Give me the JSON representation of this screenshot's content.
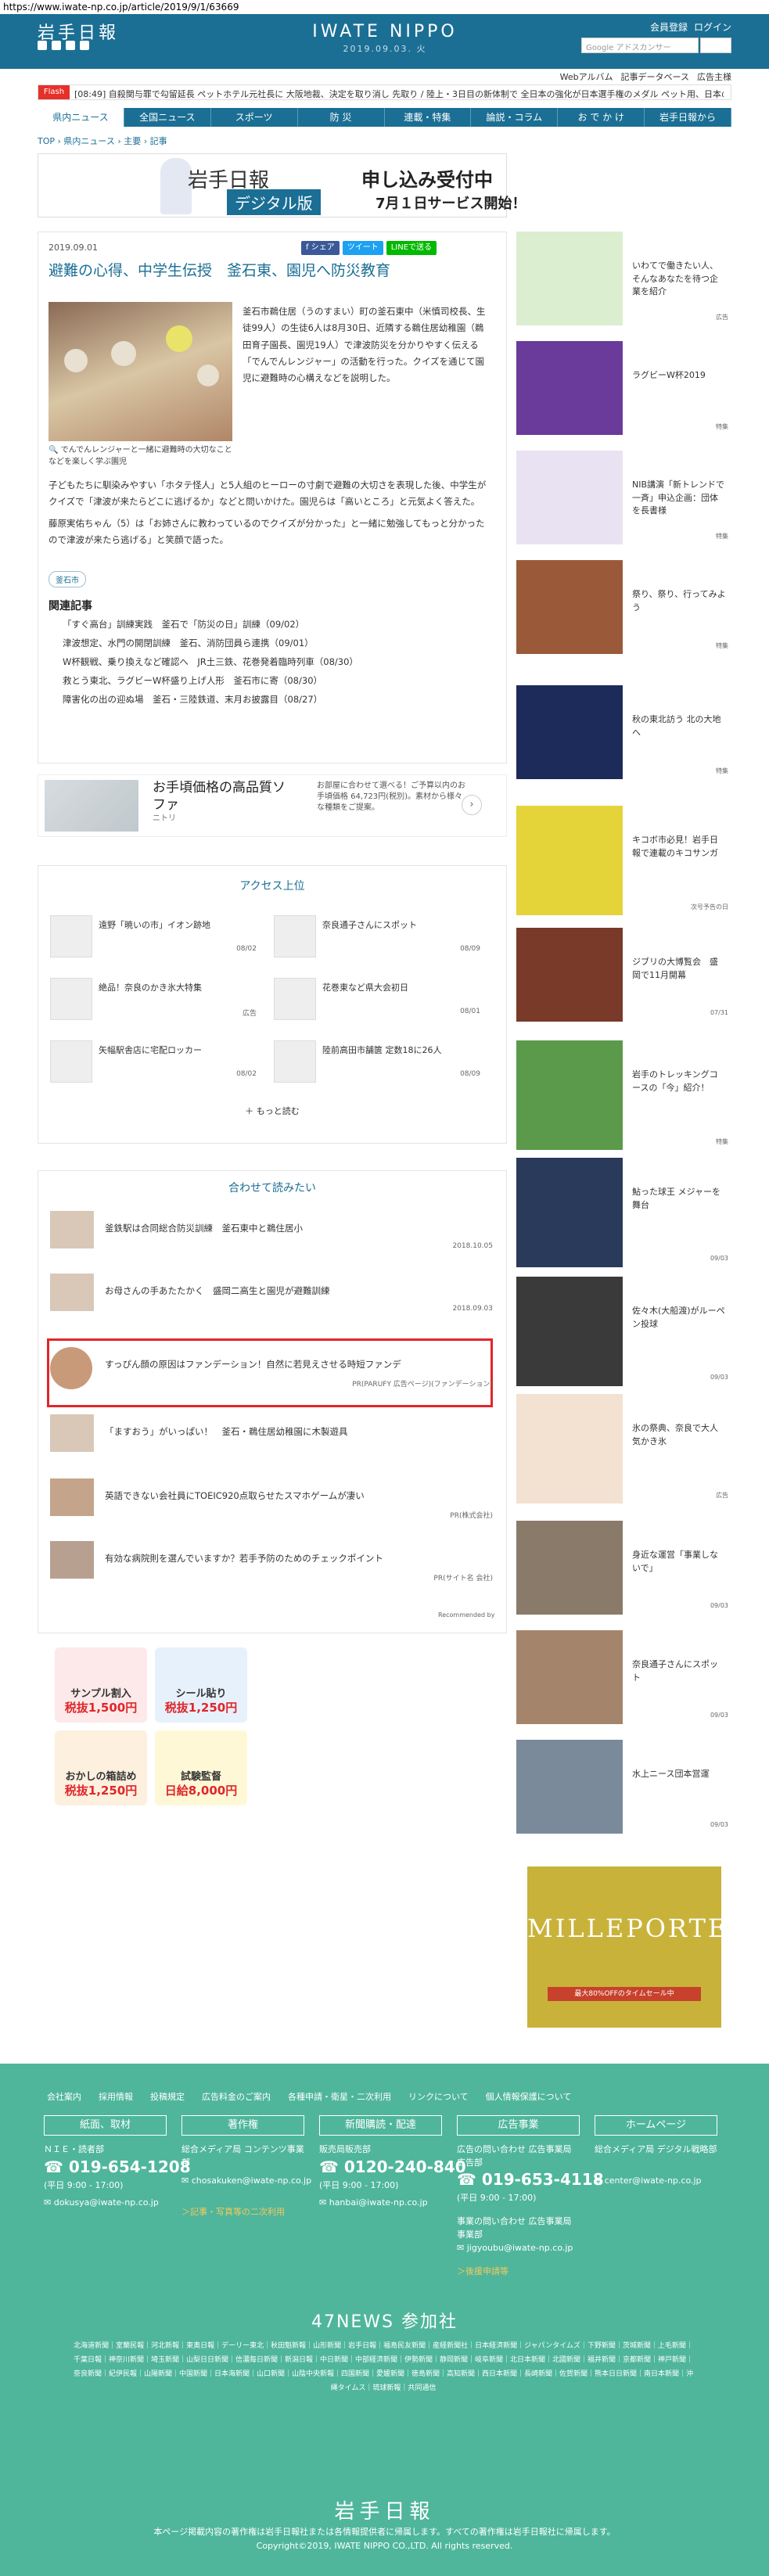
{
  "url": "https://www.iwate-np.co.jp/article/2019/9/1/63669",
  "header": {
    "logo": "岩手日報",
    "center_logo": "IWATE NIPPO",
    "date": "2019.09.03. 火",
    "member_links": [
      "会員登録",
      "ログイン"
    ],
    "search_placeholder": "Google アドスカンサー",
    "sublinks": [
      "Webアルバム",
      "記事データベース",
      "広告主様"
    ]
  },
  "flash": {
    "tag": "Flash",
    "text": "[08:49] 自殺関与罪で勾留延長 ペットホテル元社長に 大阪地裁、決定を取り消し 先取り / 陸上・3日目の新体制で 全日本の強化が日本選手権のメダル ペット用、日本の陸上競技 水泳 1-12"
  },
  "nav": [
    "県内ニュース",
    "全国ニュース",
    "スポーツ",
    "防 災",
    "連載・特集",
    "論説・コラム",
    "お で か け",
    "岩手日報から"
  ],
  "breadcrumb": "TOP › 県内ニュース › 主要 › 記事",
  "banner": {
    "logo": "岩手日報",
    "sub": "デジタル版",
    "main": "申し込み受付中",
    "date": "7月１日サービス開始！"
  },
  "article": {
    "date": "2019.09.01",
    "share": [
      "f シェア",
      "ツイート",
      "LINEで送る"
    ],
    "title": "避難の心得、中学生伝授　釜石東、園児へ防災教育",
    "caption": "でんでんレンジャーと一緒に避難時の大切なことなどを楽しく学ぶ園児",
    "body1": "釜石市鵜住居（うのすまい）町の釜石東中（米慎司校長、生徒99人）の生徒6人は8月30日、近隣する鵜住居幼稚園（鵜田育子園長、園児19人）で津波防災を分かりやすく伝える「でんでんレンジャー」の活動を行った。クイズを通じて園児に避難時の心構えなどを説明した。",
    "body2": "子どもたちに馴染みやすい「ホタテ怪人」と5人組のヒーローの寸劇で避難の大切さを表現した後、中学生がクイズで「津波が来たらどこに逃げるか」などと問いかけた。園児らは「高いところ」と元気よく答えた。",
    "body3": "藤原実佑ちゃん（5）は「お姉さんに教わっているのでクイズが分かった」と一緒に勉強してもっと分かったので津波が来たら逃げる」と笑顔で語った。",
    "tag": "釜石市",
    "related_heading": "関連記事",
    "related": [
      "「すぐ高台」訓練実践　釜石で「防災の日」訓練（09/02）",
      "津波想定、水門の開閉訓練　釜石、消防団員ら連携（09/01）",
      "W杯観戦、乗り換えなど確認へ　JR土三鉄、花巻発着臨時列車（08/30）",
      "救とう東北、ラグビーW杯盛り上げ人形　釜石市に寄（08/30）",
      "障害化の出の迎ぬ場　釜石・三陸鉄道、末月お披露目（08/27）"
    ]
  },
  "ad1": {
    "title": "お手頃価格の高品質ソファ",
    "brand": "ニトリ",
    "text": "お部屋に合わせて選べる！ご予算以内のお手頃価格 64,723円(税別)。素材から様々な種類をご提案。"
  },
  "ranking": {
    "heading": "アクセス上位",
    "items": [
      {
        "title": "遠野「暁いの市」イオン跡地",
        "date": "08/02"
      },
      {
        "title": "奈良通子さんにスポット",
        "date": "08/09"
      },
      {
        "title": "絶品！奈良のかき氷大特集",
        "date": "広告"
      },
      {
        "title": "花巻東など県大会初日",
        "date": "08/01"
      },
      {
        "title": "矢幅駅舎店に宅配ロッカー",
        "date": "08/02"
      },
      {
        "title": "陸前高田市舗篋 定数18に26人",
        "date": "08/09"
      }
    ],
    "more": "もっと読む"
  },
  "reco": {
    "heading": "合わせて読みたい",
    "items": [
      {
        "title": "釜鉄駅は合同総合防災訓練　釜石東中と鵜住居小",
        "meta": "2018.10.05"
      },
      {
        "title": "お母さんの手あたたかく　盛岡二高生と園児が避難訓練",
        "meta": "2018.09.03"
      },
      {
        "title": "すっぴん顔の原因はファンデーション！自然に若見えさせる時短ファンデ",
        "meta": "PR(PARUFY 広告ページ)(ファンデーション)"
      },
      {
        "title": "「ますおう」がいっぱい！　釜石・鵜住居幼稚園に木製遊具",
        "meta": ""
      },
      {
        "title": "英語できない会社員にTOEIC920点取らせたスマホゲームが凄い",
        "meta": "PR(株式会社)"
      },
      {
        "title": "有効な病院則を選んでいますか？若手予防のためのチェックポイント",
        "meta": "PR(サイト名 会社)"
      }
    ],
    "recommended": "Recommended by"
  },
  "ad2": [
    {
      "title": "サンプル割入",
      "price": "税抜1,500円"
    },
    {
      "title": "シール貼り",
      "price": "税抜1,250円"
    },
    {
      "title": "おかしの箱詰め",
      "price": "税抜1,250円"
    },
    {
      "title": "試験監督",
      "price": "日給8,000円"
    }
  ],
  "sidebar": [
    {
      "title": "いわてで働きたい人、そんなあなたを待つ企業を紹介",
      "date": "広告"
    },
    {
      "title": "ラグビーW杯2019",
      "date": "特集"
    },
    {
      "title": "NIB講演「新トレンドで一斉」申込企画：団体を長書様",
      "date": "特集"
    },
    {
      "title": "祭り、祭り、行ってみよう",
      "date": "特集"
    },
    {
      "title": "秋の東北訪う 北の大地へ",
      "date": "特集"
    },
    {
      "title": "キコボ市必見！岩手日報で連載のキコサンガ",
      "date": "次号予告の日"
    },
    {
      "title": "ジブリの大博覧会　盛岡で11月開幕",
      "date": "07/31"
    },
    {
      "title": "岩手のトレッキングコースの「今」紹介！",
      "date": "特集"
    },
    {
      "title": "鮎った球王 メジャーを舞台",
      "date": "09/03"
    },
    {
      "title": "佐々木(大船渡)がルーペン投球",
      "date": "09/03"
    },
    {
      "title": "氷の祭典、奈良で大人気かき氷",
      "date": "広告"
    },
    {
      "title": "身近な運営「事業しないで」",
      "date": "09/03"
    },
    {
      "title": "奈良通子さんにスポット",
      "date": "09/03"
    },
    {
      "title": "水上ニース団本営運",
      "date": "09/03"
    }
  ],
  "side_ad": {
    "title": "MILLEPORTE",
    "button": "最大80%OFFのタイムセール中"
  },
  "footer": {
    "links": [
      "会社案内",
      "採用情報",
      "投稿規定",
      "広告料金のご案内",
      "各種申請・衛星・二次利用",
      "リンクについて",
      "個人情報保護について"
    ],
    "boxes": [
      "紙面、取材",
      "著作権",
      "新聞購読・配達",
      "広告事業",
      "ホームページ"
    ],
    "col1_label": "ＮＩＥ・読者部",
    "col1_phone": "019-654-1208",
    "col1_hours": "(平日 9:00 - 17:00)",
    "col1_mail": "dokusya@iwate-np.co.jp",
    "col2_label": "総合メディア局 コンテンツ事業部",
    "col2_mail": "chosakuken@iwate-np.co.jp",
    "col2_link": "＞記事・写真等の二次利用",
    "col3_label": "販売局販売部",
    "col3_phone": "0120-240-840",
    "col3_hours": "(平日 9:00 - 17:00)",
    "col3_mail": "hanbai@iwate-np.co.jp",
    "col4_label": "広告の問い合わせ 広告事業局広告部",
    "col4_phone": "019-653-4118",
    "col4_hours": "(平日 9:00 - 17:00)",
    "col4_label2": "事業の問い合わせ 広告事業局事業部",
    "col4_mail": "jigyoubu@iwate-np.co.jp",
    "col4_link": "＞後援申請等",
    "col5_label": "総合メディア局 デジタル戦略部",
    "col5_mail": "center@iwate-np.co.jp",
    "news47": "47NEWS 参加社",
    "news47_list": "北海道新聞｜室蘭民報｜河北新報｜東奥日報｜デーリー東北｜秋田魁新報｜山形新聞｜岩手日報｜福島民友新聞｜産経新聞社｜日本経済新聞｜ジャパンタイムズ｜下野新聞｜茨城新聞｜上毛新聞｜千葉日報｜神奈川新聞｜埼玉新聞｜山梨日日新聞｜信濃毎日新聞｜新潟日報｜中日新聞｜中部経済新聞｜伊勢新聞｜静岡新聞｜岐阜新聞｜北日本新聞｜北國新聞｜福井新聞｜京都新聞｜神戸新聞｜奈良新聞｜紀伊民報｜山陽新聞｜中国新聞｜日本海新聞｜山口新聞｜山陰中央新報｜四国新聞｜愛媛新聞｜徳島新聞｜高知新聞｜西日本新聞｜長崎新聞｜佐賀新聞｜熊本日日新聞｜南日本新聞｜沖縄タイムス｜琉球新報｜共同通信",
    "logo": "岩手日報",
    "copy1": "本ページ掲載内容の著作権は岩手日報社または各情報提供者に帰属します。すべての著作権は岩手日報社に帰属します。",
    "copy2": "Copyright©2019, IWATE NIPPO CO.,LTD. All rights reserved."
  }
}
